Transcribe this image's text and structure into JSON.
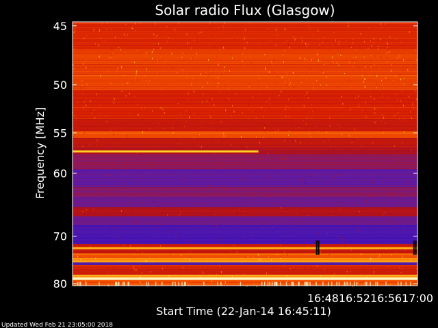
{
  "chart_data": {
    "type": "heatmap",
    "title": "Solar radio Flux (Glasgow)",
    "xlabel": "Start Time (22-Jan-14 16:45:11)",
    "ylabel": "Frequency [MHz]",
    "x_range_minutes": [
      16.2,
      60.0
    ],
    "x_ticks": [
      {
        "label": "16:48",
        "minutes": 48
      },
      {
        "label": "16:52",
        "minutes": 52
      },
      {
        "label": "16:56",
        "minutes": 56
      },
      {
        "label": "17:00",
        "minutes": 60
      }
    ],
    "ylim": [
      80.5,
      44.7
    ],
    "y_ticks": [
      45,
      50,
      55,
      60,
      70,
      80
    ],
    "y_scale": "reciprocal",
    "colormap": [
      "#3a10b8",
      "#5a1aa8",
      "#8c1a60",
      "#b0101a",
      "#d82000",
      "#ff6a00",
      "#ffd020",
      "#fff6c0"
    ],
    "frequency_bands": [
      {
        "from": 44.7,
        "to": 47.0,
        "level": 0.58
      },
      {
        "from": 47.0,
        "to": 50.5,
        "level": 0.63
      },
      {
        "from": 50.5,
        "to": 53.5,
        "level": 0.57
      },
      {
        "from": 53.5,
        "to": 54.8,
        "level": 0.5
      },
      {
        "from": 54.8,
        "to": 55.6,
        "level": 0.64
      },
      {
        "from": 55.6,
        "to": 56.8,
        "level": 0.48
      },
      {
        "from": 56.8,
        "to": 57.6,
        "level": 0.42
      },
      {
        "from": 57.6,
        "to": 59.5,
        "level": 0.3
      },
      {
        "from": 59.5,
        "to": 62.0,
        "level": 0.16
      },
      {
        "from": 62.0,
        "to": 63.5,
        "level": 0.26
      },
      {
        "from": 63.5,
        "to": 65.0,
        "level": 0.2
      },
      {
        "from": 65.0,
        "to": 66.5,
        "level": 0.44
      },
      {
        "from": 66.5,
        "to": 68.0,
        "level": 0.2
      },
      {
        "from": 68.0,
        "to": 71.5,
        "level": 0.08
      },
      {
        "from": 71.5,
        "to": 73.3,
        "level": 0.52
      },
      {
        "from": 73.3,
        "to": 74.2,
        "level": 0.66
      },
      {
        "from": 74.2,
        "to": 75.2,
        "level": 0.78
      },
      {
        "from": 75.2,
        "to": 75.8,
        "level": 0.1
      },
      {
        "from": 75.8,
        "to": 78.0,
        "level": 0.55
      },
      {
        "from": 78.0,
        "to": 78.6,
        "level": 0.82
      },
      {
        "from": 78.6,
        "to": 79.1,
        "level": 0.98
      },
      {
        "from": 79.1,
        "to": 80.5,
        "level": 0.68
      }
    ],
    "features": [
      {
        "name": "interference-line-57mhz",
        "freq": 57.2,
        "t_start": 16.2,
        "t_end": 39.8,
        "level": 0.86
      },
      {
        "name": "interference-line-72mhz",
        "freq": 72.3,
        "t_start": 16.2,
        "t_end": 60.0,
        "level": 0.82
      },
      {
        "name": "bright-band-79mhz",
        "freq": 78.9,
        "t_start": 16.2,
        "t_end": 60.0,
        "level": 1.0
      }
    ],
    "gaps": [
      {
        "minutes": 47.2,
        "freq_from": 70.8,
        "freq_to": 73.6
      },
      {
        "minutes": 47.45,
        "freq_from": 70.8,
        "freq_to": 73.6
      },
      {
        "minutes": 59.55,
        "freq_from": 70.8,
        "freq_to": 73.6
      },
      {
        "minutes": 59.8,
        "freq_from": 70.8,
        "freq_to": 73.6
      }
    ],
    "grid": false,
    "legend": "none"
  },
  "footer": {
    "updated": "Updated Wed Feb 21 23:05:00 2018"
  }
}
